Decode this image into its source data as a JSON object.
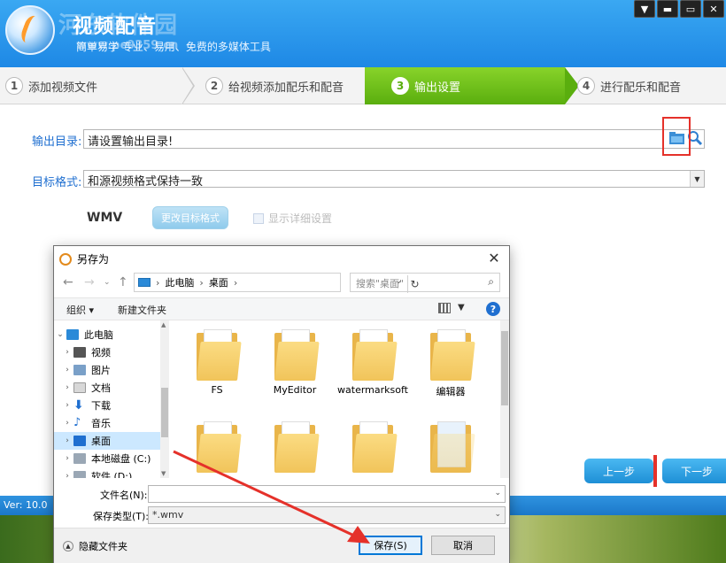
{
  "app": {
    "title": "视频配音",
    "subtitle": "简单易学 专业、易用、免费的多媒体工具",
    "watermark": "河东软件园",
    "watermark_url": "www.pc0359.cn",
    "version": "Ver: 10.0"
  },
  "window_controls": [
    "▼",
    "▬",
    "▭",
    "✕"
  ],
  "steps": [
    {
      "num": "1",
      "label": "添加视频文件"
    },
    {
      "num": "2",
      "label": "给视频添加配乐和配音"
    },
    {
      "num": "3",
      "label": "输出设置"
    },
    {
      "num": "4",
      "label": "进行配乐和配音"
    }
  ],
  "settings": {
    "output_dir_label": "输出目录:",
    "output_dir_value": "请设置输出目录!",
    "format_label": "目标格式:",
    "format_value": "和源视频格式保持一致",
    "format_name": "WMV",
    "change_format": "更改目标格式",
    "show_details": "显示详细设置",
    "prev": "上一步",
    "next": "下一步"
  },
  "dialog": {
    "title": "另存为",
    "breadcrumb": [
      "此电脑",
      "桌面"
    ],
    "search_placeholder": "搜索\"桌面\"",
    "organize": "组织 ▾",
    "new_folder": "新建文件夹",
    "tree": [
      {
        "label": "此电脑",
        "level": 0,
        "expanded": true,
        "icon": "computer-icon"
      },
      {
        "label": "视频",
        "level": 1,
        "icon": "video-icon"
      },
      {
        "label": "图片",
        "level": 1,
        "icon": "picture-icon"
      },
      {
        "label": "文档",
        "level": 1,
        "icon": "document-icon"
      },
      {
        "label": "下载",
        "level": 1,
        "icon": "download-icon"
      },
      {
        "label": "音乐",
        "level": 1,
        "icon": "music-icon"
      },
      {
        "label": "桌面",
        "level": 1,
        "selected": true,
        "icon": "desktop-icon"
      },
      {
        "label": "本地磁盘 (C:)",
        "level": 1,
        "icon": "drive-icon"
      },
      {
        "label": "软件 (D:)",
        "level": 1,
        "icon": "drive-icon"
      }
    ],
    "files": [
      {
        "name": "FS"
      },
      {
        "name": "MyEditor"
      },
      {
        "name": "watermarksoft"
      },
      {
        "name": "编辑器"
      },
      {
        "name": ""
      },
      {
        "name": ""
      },
      {
        "name": ""
      },
      {
        "name": ""
      }
    ],
    "filename_label": "文件名(N):",
    "filename_value": "",
    "filetype_label": "保存类型(T):",
    "filetype_value": "*.wmv",
    "hide_folders": "隐藏文件夹",
    "save": "保存(S)",
    "cancel": "取消"
  },
  "colors": {
    "header": "#1e88e5",
    "active_step": "#5aae0e",
    "highlight_red": "#e5312a"
  }
}
